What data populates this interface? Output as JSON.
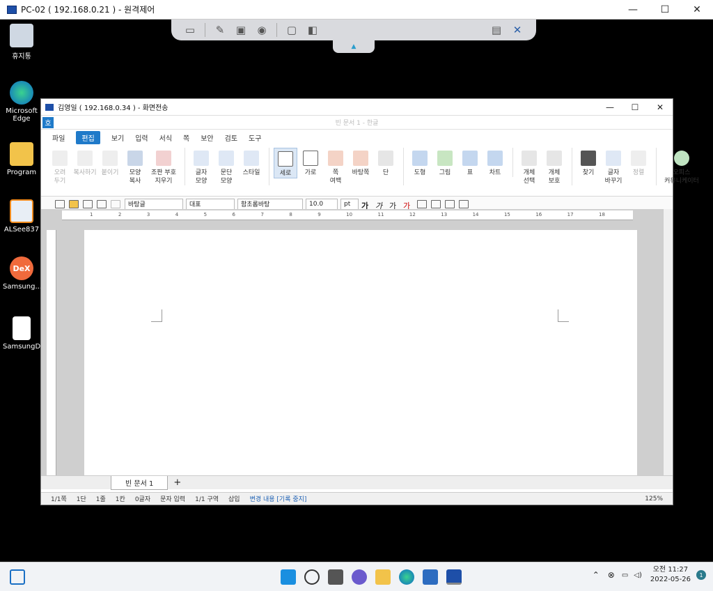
{
  "outer_window": {
    "title": "PC-02 ( 192.168.0.21 ) - 원격제어"
  },
  "desktop_icons": [
    {
      "label": "휴지통"
    },
    {
      "label": "Microsoft Edge"
    },
    {
      "label": "Program"
    },
    {
      "label": "ALSee837"
    },
    {
      "label": "Samsung..."
    },
    {
      "label": "SamsungD..."
    }
  ],
  "inner_window": {
    "title": "김영일 ( 192.168.0.34 ) - 화면전송"
  },
  "hwp": {
    "doc_title": "빈 문서 1 - 한글",
    "logo": "호",
    "menu": [
      "파일",
      "편집",
      "보기",
      "입력",
      "서식",
      "쪽",
      "보안",
      "검토",
      "도구"
    ],
    "active_menu": "편집",
    "ribbon": [
      {
        "label": "오려\n두기",
        "disabled": true
      },
      {
        "label": "복사하기",
        "disabled": true
      },
      {
        "label": "붙이기",
        "disabled": true
      },
      {
        "label": "모양\n복사"
      },
      {
        "label": "조판 부호\n지우기"
      },
      {
        "label": "글자\n모양"
      },
      {
        "label": "문단\n모양"
      },
      {
        "label": "스타일"
      },
      {
        "label": "세로",
        "selected": true
      },
      {
        "label": "가로"
      },
      {
        "label": "쪽\n여백"
      },
      {
        "label": "바탕쪽"
      },
      {
        "label": "단"
      },
      {
        "label": "도형"
      },
      {
        "label": "그림"
      },
      {
        "label": "표"
      },
      {
        "label": "차트"
      },
      {
        "label": "개체\n선택"
      },
      {
        "label": "개체\n보호"
      },
      {
        "label": "찾기"
      },
      {
        "label": "글자\n바꾸기"
      },
      {
        "label": "정렬",
        "disabled": true
      },
      {
        "label": "오피스\n커뮤니케이터"
      }
    ],
    "format": {
      "style": "바탕글",
      "type": "대표",
      "font": "함초롬바탕",
      "size": "10.0",
      "unit": "pt"
    },
    "ruler_numbers": [
      "1",
      "2",
      "3",
      "4",
      "5",
      "6",
      "7",
      "8",
      "9",
      "10",
      "11",
      "12",
      "13",
      "14",
      "15",
      "16",
      "17",
      "18"
    ],
    "bottom_tab": "빈 문서 1",
    "status": [
      "1/1쪽",
      "1단",
      "1줄",
      "1칸",
      "0글자",
      "문자 입력",
      "1/1 구역",
      "삽입"
    ],
    "status_change": "변경 내용 [기록 중지]",
    "zoom": "125%"
  },
  "taskbar": {
    "time": "오전 11:27",
    "date": "2022-05-26",
    "badge": "1"
  }
}
